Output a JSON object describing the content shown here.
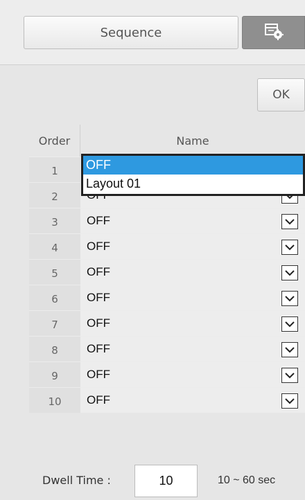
{
  "toolbar": {
    "sequence_label": "Sequence",
    "settings_icon": "layout-settings-icon"
  },
  "ok_label": "OK",
  "table": {
    "headers": {
      "order": "Order",
      "name": "Name"
    },
    "rows": [
      {
        "order": "1",
        "name": "OFF"
      },
      {
        "order": "2",
        "name": "OFF"
      },
      {
        "order": "3",
        "name": "OFF"
      },
      {
        "order": "4",
        "name": "OFF"
      },
      {
        "order": "5",
        "name": "OFF"
      },
      {
        "order": "6",
        "name": "OFF"
      },
      {
        "order": "7",
        "name": "OFF"
      },
      {
        "order": "8",
        "name": "OFF"
      },
      {
        "order": "9",
        "name": "OFF"
      },
      {
        "order": "10",
        "name": "OFF"
      }
    ]
  },
  "dropdown": {
    "options": [
      "OFF",
      "Layout 01"
    ],
    "selected": "OFF"
  },
  "footer": {
    "dwell_label": "Dwell Time :",
    "dwell_value": "10",
    "dwell_range": "10 ~ 60 sec"
  },
  "colors": {
    "selected_option": "#2e99e0",
    "settings_button": "#8f8f8f"
  }
}
